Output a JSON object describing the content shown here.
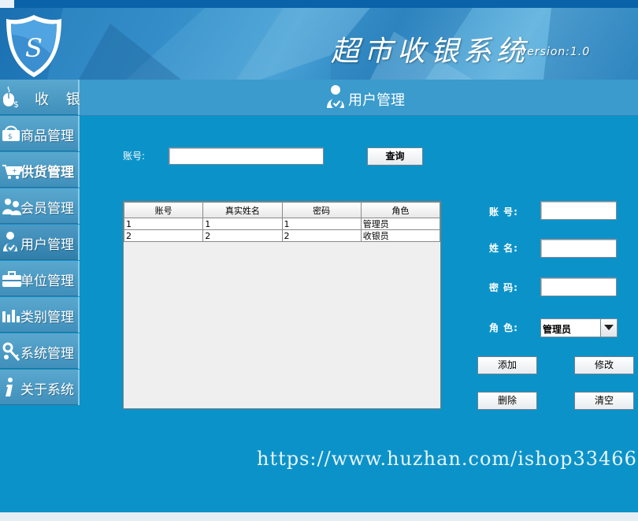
{
  "app": {
    "title": "超市收银系统",
    "version": "version:1.0",
    "logo_letter": "S"
  },
  "sidebar": {
    "items": [
      {
        "label": "收 银",
        "icon": "cashier-mouse-icon"
      },
      {
        "label": "商品管理",
        "icon": "money-icon"
      },
      {
        "label": "供货管理",
        "icon": "cart-icon"
      },
      {
        "label": "会员管理",
        "icon": "members-icon"
      },
      {
        "label": "用户管理",
        "icon": "user-check-icon"
      },
      {
        "label": "单位管理",
        "icon": "briefcase-icon"
      },
      {
        "label": "类别管理",
        "icon": "bar-chart-icon"
      },
      {
        "label": "系统管理",
        "icon": "keys-icon"
      },
      {
        "label": "关于系统",
        "icon": "info-icon"
      }
    ]
  },
  "page": {
    "title": "用户管理",
    "icon": "user-check-icon"
  },
  "search": {
    "label": "账号:",
    "value": "",
    "button": "查询"
  },
  "table": {
    "columns": [
      "账号",
      "真实姓名",
      "密码",
      "角色"
    ],
    "rows": [
      [
        "1",
        "1",
        "1",
        "管理员"
      ],
      [
        "2",
        "2",
        "2",
        "收银员"
      ]
    ]
  },
  "form": {
    "account_label": "账 号:",
    "account_value": "",
    "name_label": "姓 名:",
    "name_value": "",
    "password_label": "密 码:",
    "password_value": "",
    "role_label": "角 色:",
    "role_value": "管理员"
  },
  "buttons": {
    "add": "添加",
    "edit": "修改",
    "delete": "删除",
    "clear": "清空"
  },
  "watermark": "https://www.huzhan.com/ishop33466",
  "colors": {
    "background": "#0b93c9",
    "header": "#3a9bcc",
    "sidebar": "#4a9bc6"
  }
}
